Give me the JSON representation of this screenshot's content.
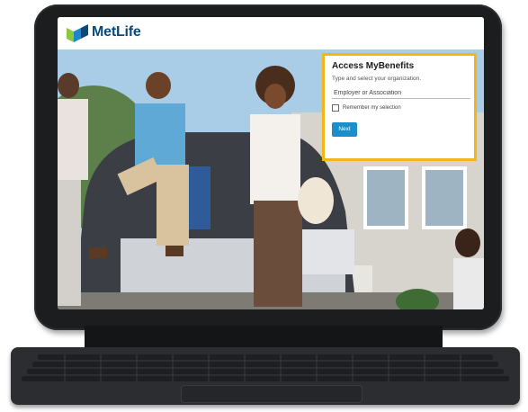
{
  "app": {
    "brand": "MetLife"
  },
  "login_card": {
    "title": "Access MyBenefits",
    "subtitle": "Type and select your organization.",
    "org_placeholder": "Employer or Association",
    "remember_label": "Remember my selection",
    "next_button": "Next"
  },
  "colors": {
    "brand_blue": "#0a4a7a",
    "logo_green": "#8dc63f",
    "card_border": "#f2b61a",
    "button_blue": "#1c8ec9"
  }
}
